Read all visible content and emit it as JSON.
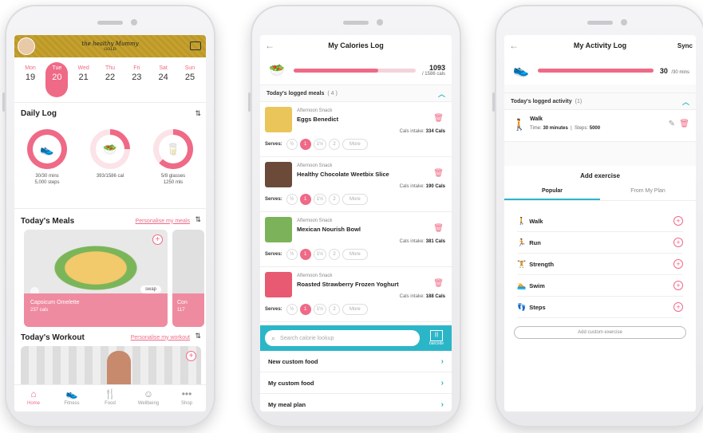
{
  "home": {
    "days": [
      {
        "name": "Mon",
        "num": "19"
      },
      {
        "name": "Tue",
        "num": "20"
      },
      {
        "name": "Wed",
        "num": "21"
      },
      {
        "name": "Thu",
        "num": "22"
      },
      {
        "name": "Fri",
        "num": "23"
      },
      {
        "name": "Sat",
        "num": "24"
      },
      {
        "name": "Sun",
        "num": "25"
      }
    ],
    "active_day_index": 1,
    "brand": "the healthy Mummy",
    "brand_sub": "GOLD",
    "daily_log_title": "Daily Log",
    "rings": [
      {
        "line1": "30/30 mins",
        "line2": "5,000 steps",
        "fraction": 1.0,
        "icon": "shoe-icon"
      },
      {
        "line1": "393/1586 cal",
        "line2": "",
        "fraction": 0.25,
        "icon": "food-bowl-icon"
      },
      {
        "line1": "5/8 glasses",
        "line2": "1250 mls",
        "fraction": 0.625,
        "icon": "water-glass-icon"
      }
    ],
    "meals_title": "Today's Meals",
    "personalise_meals": "Personalise my meals",
    "meal_card": {
      "name": "Capsicum Omelette",
      "cals": "237 cals",
      "swap": "swap"
    },
    "meal_card2": {
      "name": "Con",
      "cals": "117"
    },
    "workout_title": "Today's Workout",
    "personalise_workout": "Personalise my workout",
    "tabs": [
      {
        "label": "Home",
        "icon": "home-icon"
      },
      {
        "label": "Fitness",
        "icon": "shoe-icon"
      },
      {
        "label": "Food",
        "icon": "cutlery-icon"
      },
      {
        "label": "Wellbeing",
        "icon": "wellbeing-icon"
      },
      {
        "label": "Shop",
        "icon": "more-icon"
      }
    ]
  },
  "calories": {
    "title": "My Calories Log",
    "total": "1093",
    "goal": "/ 1586 cals",
    "fraction": 0.69,
    "logged_label": "Today's logged meals",
    "logged_count": "( 4 )",
    "foods": [
      {
        "type": "Afternoon Snack",
        "name": "Eggs Benedict",
        "cals_label": "Cals intake:",
        "cals": "334 Cals",
        "color": "#e9c55a"
      },
      {
        "type": "Afternoon Snack",
        "name": "Healthy Chocolate Weetbix Slice",
        "cals_label": "Cals intake:",
        "cals": "190 Cals",
        "color": "#6b4a3a"
      },
      {
        "type": "Afternoon Snack",
        "name": "Mexican Nourish Bowl",
        "cals_label": "Cals intake:",
        "cals": "381 Cals",
        "color": "#7cb35a"
      },
      {
        "type": "Afternoon Snack",
        "name": "Roasted Strawberry Frozen Yoghurt",
        "cals_label": "Cals intake:",
        "cals": "188 Cals",
        "color": "#e85a72"
      }
    ],
    "serves_label": "Serves:",
    "serve_options": [
      "½",
      "1",
      "1½",
      "2",
      "More"
    ],
    "active_serve_index": 1,
    "search_placeholder": "Search calorie lookup",
    "barcode_label": "barcode",
    "menu": [
      "New custom food",
      "My custom food",
      "My meal plan"
    ]
  },
  "activity": {
    "title": "My Activity Log",
    "sync": "Sync",
    "total": "30",
    "goal": "/30 mins",
    "fraction": 1.0,
    "logged_label": "Today's logged activity",
    "logged_count": "(1)",
    "item": {
      "name": "Walk",
      "time_label": "Time:",
      "time": "30 minutes",
      "steps_label": "Steps:",
      "steps": "5000"
    },
    "add_title": "Add exercise",
    "subtabs": [
      "Popular",
      "From My Plan"
    ],
    "exercises": [
      {
        "name": "Walk",
        "icon": "walk-icon"
      },
      {
        "name": "Run",
        "icon": "run-icon"
      },
      {
        "name": "Strength",
        "icon": "strength-icon"
      },
      {
        "name": "Swim",
        "icon": "swim-icon"
      },
      {
        "name": "Steps",
        "icon": "steps-icon"
      }
    ],
    "custom_btn": "Add custom exercise"
  }
}
